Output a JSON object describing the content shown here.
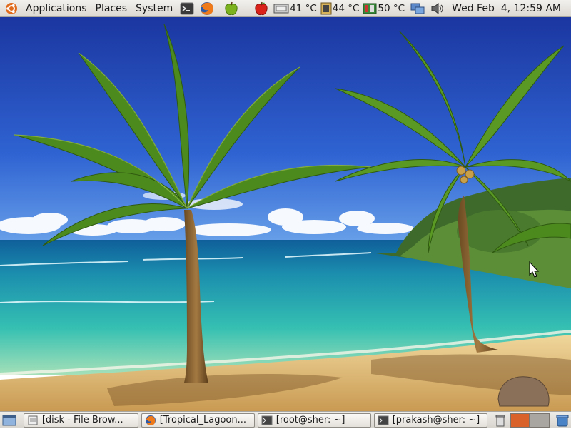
{
  "top_panel": {
    "menus": [
      "Applications",
      "Places",
      "System"
    ],
    "temps": [
      "41 °C",
      "44 °C",
      "50 °C"
    ],
    "clock": "Wed Feb  4, 12:59 AM"
  },
  "taskbar": {
    "tasks": [
      {
        "label": "[disk - File Brow..."
      },
      {
        "label": "[Tropical_Lagoon..."
      },
      {
        "label": "[root@sher: ~]"
      },
      {
        "label": "[prakash@sher: ~]"
      }
    ]
  },
  "colors": {
    "panel": "#dcd8d2",
    "sky_top": "#1f3fa8",
    "sea": "#1ea6a6",
    "sand": "#e9c98a",
    "workspace_active": "#d9622b"
  },
  "icons": {
    "ubuntu": "ubuntu-logo-icon",
    "terminal": "terminal-icon",
    "firefox": "firefox-icon",
    "green_apple": "green-apple-icon",
    "red_apple": "red-apple-icon",
    "network": "network-icon",
    "volume": "volume-icon",
    "show_desktop": "show-desktop-icon",
    "trash": "trash-icon"
  }
}
